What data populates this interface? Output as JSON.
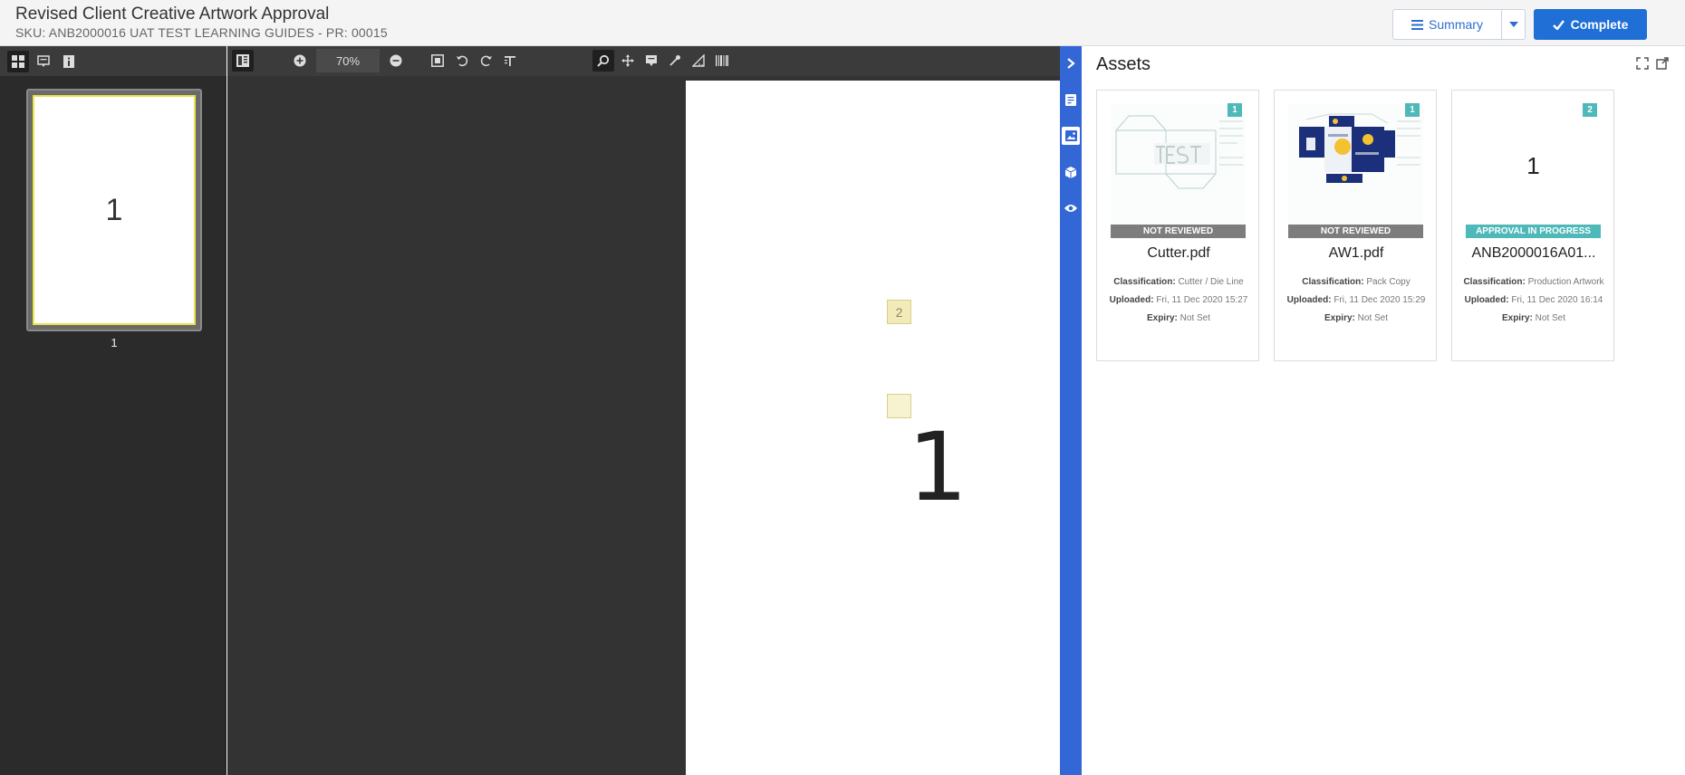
{
  "header": {
    "title": "Revised Client Creative Artwork Approval",
    "subtitle": "SKU: ANB2000016 UAT TEST LEARNING GUIDES - PR: 00015",
    "summary_label": "Summary",
    "complete_label": "Complete"
  },
  "thumbnails": {
    "toolbar_icons": [
      "grid-icon",
      "comment-icon",
      "info-icon"
    ],
    "items": [
      {
        "page_number": "1",
        "label": "1"
      }
    ]
  },
  "viewer": {
    "zoom": "70%",
    "page_number": "1",
    "markers": [
      "2",
      ""
    ]
  },
  "side_tabs": [
    "collapse-arrow-icon",
    "document-icon",
    "image-icon",
    "cube-icon",
    "eye-icon"
  ],
  "assets": {
    "title": "Assets",
    "cards": [
      {
        "badge": "1",
        "status": "NOT REVIEWED",
        "filename": "Cutter.pdf",
        "classification_label": "Classification:",
        "classification": "Cutter / Die Line",
        "uploaded_label": "Uploaded:",
        "uploaded": "Fri, 11 Dec 2020 15:27",
        "expiry_label": "Expiry:",
        "expiry": "Not Set"
      },
      {
        "badge": "1",
        "status": "NOT REVIEWED",
        "filename": "AW1.pdf",
        "classification_label": "Classification:",
        "classification": "Pack Copy",
        "uploaded_label": "Uploaded:",
        "uploaded": "Fri, 11 Dec 2020 15:29",
        "expiry_label": "Expiry:",
        "expiry": "Not Set"
      },
      {
        "badge": "2",
        "status": "APPROVAL IN PROGRESS",
        "filename": "ANB2000016A01...",
        "preview_text": "1",
        "classification_label": "Classification:",
        "classification": "Production Artwork",
        "uploaded_label": "Uploaded:",
        "uploaded": "Fri, 11 Dec 2020 16:14",
        "expiry_label": "Expiry:",
        "expiry": "Not Set"
      }
    ]
  },
  "colors": {
    "accent": "#1f6fd6",
    "side_strip": "#3367d6",
    "status_gray": "#7d7d7d",
    "status_teal": "#4fb8b8"
  }
}
